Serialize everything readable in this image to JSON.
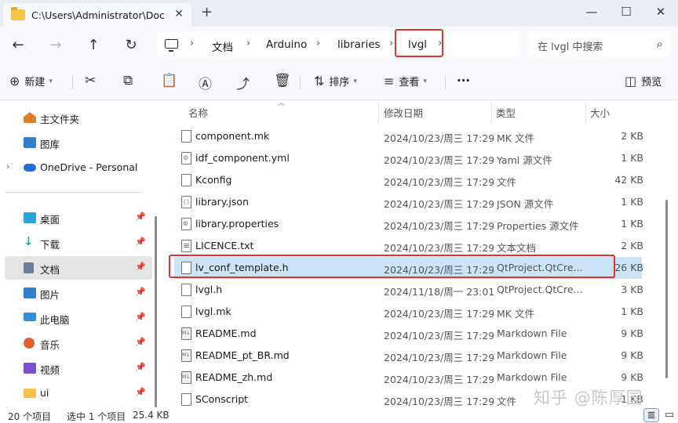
{
  "window": {
    "tab_title": "C:\\Users\\Administrator\\Docun",
    "new_tab_glyph": "+",
    "close_tab_glyph": "✕",
    "controls": {
      "minimize": "—",
      "maximize": "☐",
      "close": "✕"
    }
  },
  "nav": {
    "back": "←",
    "forward": "→",
    "up": "↑",
    "refresh": "↻"
  },
  "breadcrumb": {
    "items": [
      "文档",
      "Arduino",
      "libraries",
      "lvgl"
    ],
    "separator": "›",
    "current": "lvgl"
  },
  "search": {
    "placeholder": "在 lvgl 中搜索",
    "icon": "search-icon"
  },
  "toolbar": {
    "new_label": "新建",
    "sort_label": "排序",
    "view_label": "查看",
    "more_label": "···",
    "preview_label": "预览"
  },
  "sidebar": {
    "items": [
      {
        "label": "主文件夹",
        "icon": "home-icon",
        "color": "#d9822b"
      },
      {
        "label": "图库",
        "icon": "gallery-icon",
        "color": "#2f7fd6"
      },
      {
        "label": "OneDrive - Personal",
        "icon": "onedrive-icon",
        "color": "#1f6fd1"
      },
      {
        "label": "桌面",
        "icon": "desktop-icon",
        "color": "#2aa3d8"
      },
      {
        "label": "下载",
        "icon": "download-icon",
        "color": "#1b9a6a"
      },
      {
        "label": "文档",
        "icon": "documents-icon",
        "color": "#6d7f94"
      },
      {
        "label": "图片",
        "icon": "pictures-icon",
        "color": "#2f7fd6"
      },
      {
        "label": "此电脑",
        "icon": "this-pc-icon",
        "color": "#2f8fe0"
      },
      {
        "label": "音乐",
        "icon": "music-icon",
        "color": "#e0612b"
      },
      {
        "label": "视频",
        "icon": "video-icon",
        "color": "#7a4fd1"
      },
      {
        "label": "ui",
        "icon": "folder-icon",
        "color": "#f4c24a"
      }
    ]
  },
  "columns": {
    "name": "名称",
    "date": "修改日期",
    "type": "类型",
    "size": "大小"
  },
  "files": [
    {
      "name": "component.mk",
      "date": "2024/10/23/周三 17:29",
      "type": "MK 文件",
      "size": "2 KB",
      "icon": "file-icon"
    },
    {
      "name": "idf_component.yml",
      "date": "2024/10/23/周三 17:29",
      "type": "Yaml 源文件",
      "size": "1 KB",
      "icon": "file-gear-icon"
    },
    {
      "name": "Kconfig",
      "date": "2024/10/23/周三 17:29",
      "type": "文件",
      "size": "42 KB",
      "icon": "file-icon"
    },
    {
      "name": "library.json",
      "date": "2024/10/23/周三 17:29",
      "type": "JSON 源文件",
      "size": "1 KB",
      "icon": "json-file-icon"
    },
    {
      "name": "library.properties",
      "date": "2024/10/23/周三 17:29",
      "type": "Properties 源文件",
      "size": "1 KB",
      "icon": "file-gear-icon"
    },
    {
      "name": "LICENCE.txt",
      "date": "2024/10/23/周三 17:29",
      "type": "文本文档",
      "size": "2 KB",
      "icon": "text-file-icon"
    },
    {
      "name": "lv_conf_template.h",
      "date": "2024/10/23/周三 17:29",
      "type": "QtProject.QtCre...",
      "size": "26 KB",
      "icon": "file-icon",
      "selected": true
    },
    {
      "name": "lvgl.h",
      "date": "2024/11/18/周一 23:01",
      "type": "QtProject.QtCre...",
      "size": "3 KB",
      "icon": "file-icon"
    },
    {
      "name": "lvgl.mk",
      "date": "2024/10/23/周三 17:29",
      "type": "MK 文件",
      "size": "1 KB",
      "icon": "file-icon"
    },
    {
      "name": "README.md",
      "date": "2024/10/23/周三 17:29",
      "type": "Markdown File",
      "size": "9 KB",
      "icon": "markdown-file-icon"
    },
    {
      "name": "README_pt_BR.md",
      "date": "2024/10/23/周三 17:29",
      "type": "Markdown File",
      "size": "9 KB",
      "icon": "markdown-file-icon"
    },
    {
      "name": "README_zh.md",
      "date": "2024/10/23/周三 17:29",
      "type": "Markdown File",
      "size": "9 KB",
      "icon": "markdown-file-icon"
    },
    {
      "name": "SConscript",
      "date": "2024/10/23/周三 17:29",
      "type": "文件",
      "size": "1 KB",
      "icon": "file-icon"
    }
  ],
  "status": {
    "item_count": "20 个项目",
    "selection": "选中 1 个项目",
    "selection_size": "25.4 KB"
  },
  "watermark": "知乎 @陈厚国",
  "colors": {
    "highlight_red": "#e0322c",
    "selection_blue": "#cce4f7"
  }
}
